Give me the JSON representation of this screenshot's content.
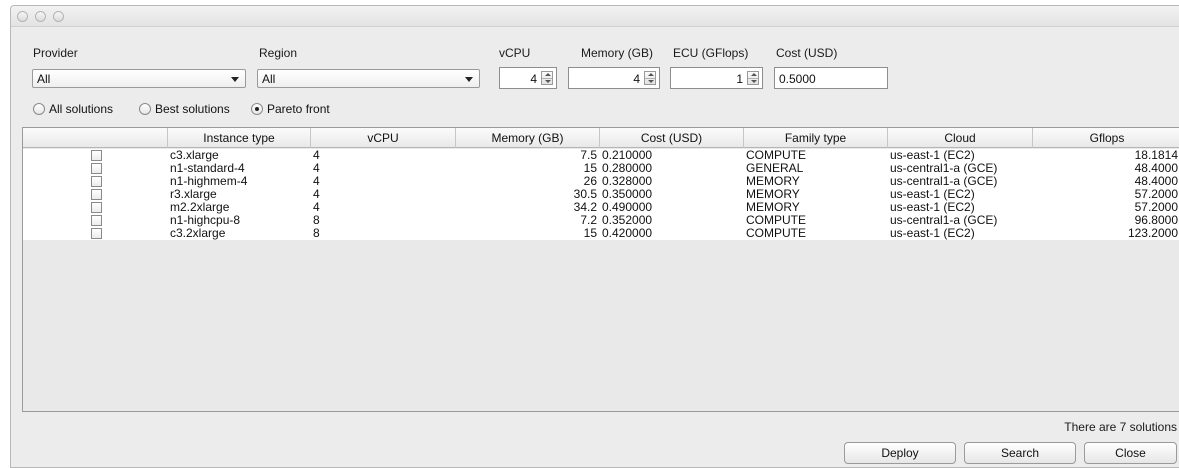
{
  "filters": {
    "provider": {
      "label": "Provider",
      "value": "All"
    },
    "region": {
      "label": "Region",
      "value": "All"
    },
    "vcpu": {
      "label": "vCPU",
      "value": "4"
    },
    "memory": {
      "label": "Memory (GB)",
      "value": "4"
    },
    "ecu": {
      "label": "ECU (GFlops)",
      "value": "1"
    },
    "cost": {
      "label": "Cost (USD)",
      "value": "0.5000"
    }
  },
  "modes": {
    "options": [
      "All solutions",
      "Best solutions",
      "Pareto front"
    ],
    "selected": "Pareto front"
  },
  "table": {
    "columns": [
      "",
      "Instance type",
      "vCPU",
      "Memory (GB)",
      "Cost (USD)",
      "Family type",
      "Cloud",
      "Gflops"
    ],
    "rows": [
      {
        "instance": "c3.xlarge",
        "vcpu": "4",
        "memory": "7.5",
        "cost": "0.210000",
        "family": "COMPUTE",
        "cloud": "us-east-1 (EC2)",
        "gflops": "18.1814"
      },
      {
        "instance": "n1-standard-4",
        "vcpu": "4",
        "memory": "15",
        "cost": "0.280000",
        "family": "GENERAL",
        "cloud": "us-central1-a (GCE)",
        "gflops": "48.4000"
      },
      {
        "instance": "n1-highmem-4",
        "vcpu": "4",
        "memory": "26",
        "cost": "0.328000",
        "family": "MEMORY",
        "cloud": "us-central1-a (GCE)",
        "gflops": "48.4000"
      },
      {
        "instance": "r3.xlarge",
        "vcpu": "4",
        "memory": "30.5",
        "cost": "0.350000",
        "family": "MEMORY",
        "cloud": "us-east-1 (EC2)",
        "gflops": "57.2000"
      },
      {
        "instance": "m2.2xlarge",
        "vcpu": "4",
        "memory": "34.2",
        "cost": "0.490000",
        "family": "MEMORY",
        "cloud": "us-east-1 (EC2)",
        "gflops": "57.2000"
      },
      {
        "instance": "n1-highcpu-8",
        "vcpu": "8",
        "memory": "7.2",
        "cost": "0.352000",
        "family": "COMPUTE",
        "cloud": "us-central1-a (GCE)",
        "gflops": "96.8000"
      },
      {
        "instance": "c3.2xlarge",
        "vcpu": "8",
        "memory": "15",
        "cost": "0.420000",
        "family": "COMPUTE",
        "cloud": "us-east-1 (EC2)",
        "gflops": "123.2000"
      }
    ]
  },
  "status": "There are 7 solutions",
  "buttons": {
    "deploy": "Deploy",
    "search": "Search",
    "close": "Close"
  }
}
